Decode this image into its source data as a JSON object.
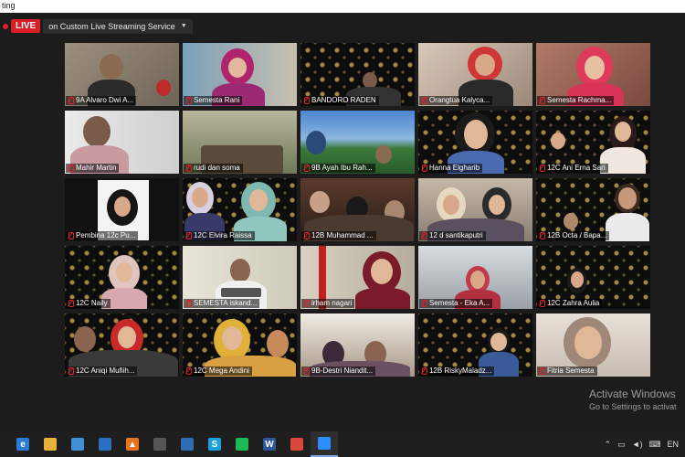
{
  "window": {
    "title": "ting"
  },
  "live": {
    "badge": "LIVE",
    "service": "on Custom Live Streaming Service"
  },
  "participants": [
    {
      "name": "9A Alvaro Dwi A..."
    },
    {
      "name": "Semesta Rani"
    },
    {
      "name": "BANDORO RADEN"
    },
    {
      "name": "Orangtua Kalyca..."
    },
    {
      "name": "Semesta Rachma..."
    },
    {
      "name": "Mahir Martin"
    },
    {
      "name": "rudi dan soma"
    },
    {
      "name": "9B Ayah Ibu Rah..."
    },
    {
      "name": "Hanna Elgharib"
    },
    {
      "name": "12C Ani Erna Sari"
    },
    {
      "name": "Pembina 12c Pu..."
    },
    {
      "name": "12C Elvira Raissa"
    },
    {
      "name": "12B Muhammad ..."
    },
    {
      "name": "12 d santikaputri"
    },
    {
      "name": "12B Octa / Bapa..."
    },
    {
      "name": "12C Naily"
    },
    {
      "name": "SEMESTA iskand..."
    },
    {
      "name": "irham nagari"
    },
    {
      "name": "Semesta - Eka A..."
    },
    {
      "name": "12C Zahra Aulia"
    },
    {
      "name": "12C Aniqi Mufiih..."
    },
    {
      "name": "12C Mega Andini"
    },
    {
      "name": "9B-Destri Niandit..."
    },
    {
      "name": "12B RiskyMaladz..."
    },
    {
      "name": "Fitria Semesta"
    }
  ],
  "watermark": {
    "line1": "Activate Windows",
    "line2": "Go to Settings to activat"
  },
  "taskbar": {
    "apps": [
      {
        "icon": "edge-icon",
        "glyph": "e",
        "color": "#2c7ad6"
      },
      {
        "icon": "file-explorer-icon",
        "glyph": "",
        "color": "#e8b03a"
      },
      {
        "icon": "store-icon",
        "glyph": "",
        "color": "#3d8fd6"
      },
      {
        "icon": "mail-icon",
        "glyph": "",
        "color": "#2a6fc4"
      },
      {
        "icon": "vlc-icon",
        "glyph": "▲",
        "color": "#e8731c"
      },
      {
        "icon": "app-icon",
        "glyph": "",
        "color": "#555"
      },
      {
        "icon": "photos-icon",
        "glyph": "",
        "color": "#2f6db5"
      },
      {
        "icon": "skype-icon",
        "glyph": "S",
        "color": "#1a9fe0"
      },
      {
        "icon": "spotify-icon",
        "glyph": "",
        "color": "#1db954"
      },
      {
        "icon": "word-icon",
        "glyph": "W",
        "color": "#2b579a"
      },
      {
        "icon": "chrome-icon",
        "glyph": "",
        "color": "#d9483b"
      },
      {
        "icon": "zoom-icon",
        "glyph": "",
        "color": "#2d8cff"
      }
    ],
    "tray_lang": "EN"
  }
}
